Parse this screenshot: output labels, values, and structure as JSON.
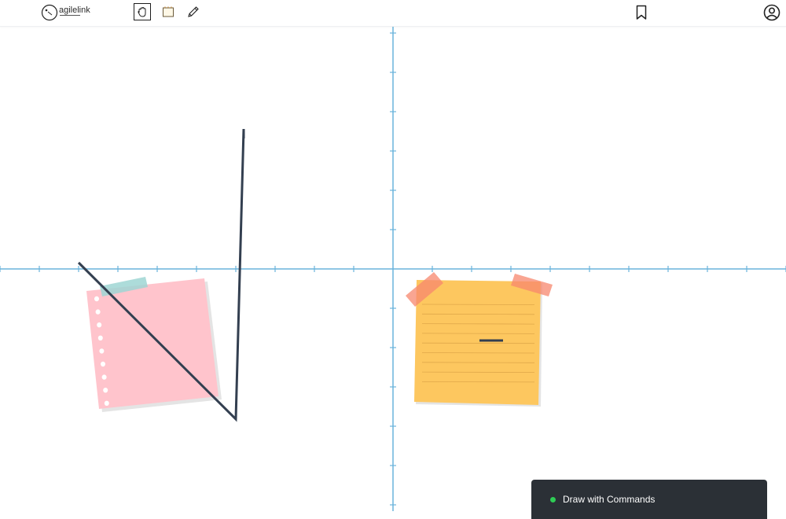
{
  "app": {
    "logo_text": "agilelink"
  },
  "toolbar": {
    "tools": [
      {
        "name": "hand-tool",
        "icon": "hand-icon",
        "active": true
      },
      {
        "name": "sticky-note-tool",
        "icon": "sticky-note-icon",
        "active": false
      },
      {
        "name": "pencil-tool",
        "icon": "pencil-icon",
        "active": false
      }
    ],
    "bookmark_icon": "bookmark-icon",
    "account_icon": "account-circle-icon"
  },
  "board": {
    "axis_color": "#6ab4dc",
    "stroke_color": "#333f50",
    "notes": [
      {
        "name": "pink-notebook-note",
        "color": "#ffc4cc",
        "tape_color": "#9fd6d4"
      },
      {
        "name": "orange-lined-note",
        "color": "#fdc75f",
        "tape_color": "#f7876d"
      }
    ]
  },
  "command_panel": {
    "label": "Draw with Commands",
    "status_color": "#2ecc55"
  }
}
